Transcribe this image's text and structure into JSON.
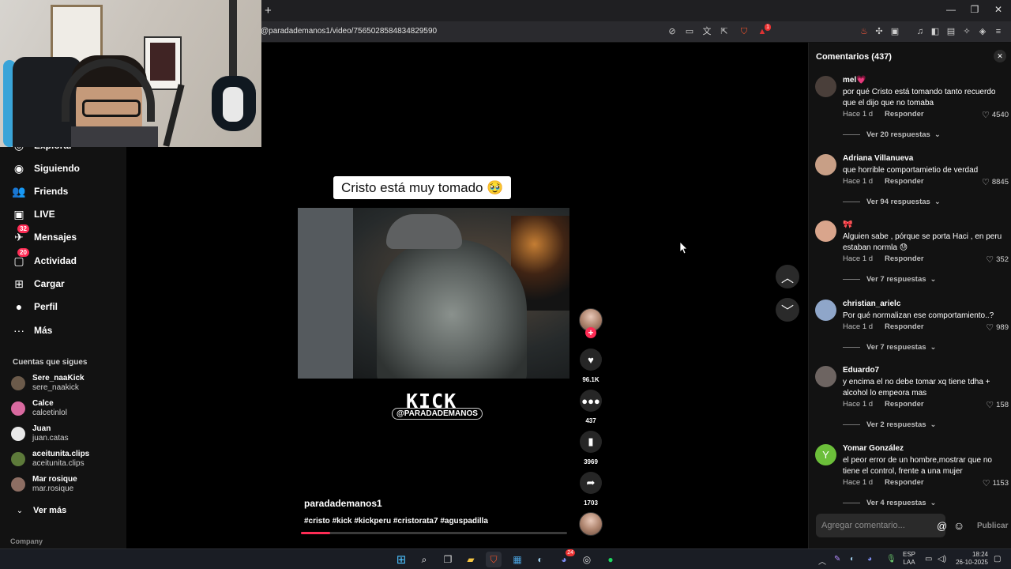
{
  "browser": {
    "new_tab": "+",
    "url": "@paradademanos1/video/7565028584834829590",
    "window_controls": [
      "—",
      "❐",
      "✕"
    ],
    "brave_badge": "1"
  },
  "nav": {
    "items": [
      {
        "label": "Explorar",
        "icon": "compass-icon",
        "glyph": "◎"
      },
      {
        "label": "Siguiendo",
        "icon": "following-icon",
        "glyph": "◉"
      },
      {
        "label": "Friends",
        "icon": "friends-icon",
        "glyph": "👥"
      },
      {
        "label": "LIVE",
        "icon": "live-icon",
        "glyph": "▣"
      },
      {
        "label": "Mensajes",
        "icon": "messages-icon",
        "glyph": "✈",
        "badge": "32"
      },
      {
        "label": "Actividad",
        "icon": "activity-icon",
        "glyph": "▢",
        "badge": "20"
      },
      {
        "label": "Cargar",
        "icon": "upload-icon",
        "glyph": "⊞"
      },
      {
        "label": "Perfil",
        "icon": "profile-icon",
        "glyph": "●"
      },
      {
        "label": "Más",
        "icon": "more-icon",
        "glyph": "···"
      }
    ],
    "following_header": "Cuentas que sigues",
    "accounts": [
      {
        "name": "Sere_naaKick",
        "handle": "sere_naakick",
        "color": "#6b5a4a"
      },
      {
        "name": "Calce",
        "handle": "calcetinlol",
        "color": "#d96aa0"
      },
      {
        "name": "Juan",
        "handle": "juan.catas",
        "color": "#e8e8e8"
      },
      {
        "name": "aceitunita.clips",
        "handle": "aceitunita.clips",
        "color": "#5d7a3a"
      },
      {
        "name": "Mar rosique",
        "handle": "mar.rosique",
        "color": "#8d6e63"
      }
    ],
    "see_more": "Ver más",
    "company": "Company"
  },
  "video": {
    "caption": "Cristo está muy tomado 🥹",
    "kick_logo": "KICK",
    "kick_handle": "@PARADADEMANOS",
    "username": "paradademanos1",
    "hashtags": "#cristo #kick #kickperu #cristorata7 #aguspadilla",
    "progress": 0.11,
    "accent": "#fe2c55"
  },
  "actions": {
    "follow": "+",
    "likes": "96.1K",
    "comments": "437",
    "saves": "3969",
    "shares": "1703"
  },
  "comments_panel": {
    "title": "Comentarios (437)",
    "close": "✕",
    "items": [
      {
        "user": "mel💗",
        "text": "por qué Cristo está tomando tanto recuerdo que el dijo que no tomaba",
        "time": "Hace 1 d",
        "reply": "Responder",
        "likes": "4540",
        "replies": "Ver 20 respuestas",
        "avatar_color": "#4a3f3a",
        "avatar_letter": ""
      },
      {
        "user": "Adriana Villanueva",
        "text": "que horrible comportamietio de verdad",
        "time": "Hace 1 d",
        "reply": "Responder",
        "likes": "8845",
        "replies": "Ver 94 respuestas",
        "avatar_color": "#c89f86",
        "avatar_letter": ""
      },
      {
        "user": "🎀",
        "text": "Alguien sabe , pórque se porta Haci , en peru estaban normla 😓",
        "time": "Hace 1 d",
        "reply": "Responder",
        "likes": "352",
        "replies": "Ver 7 respuestas",
        "avatar_color": "#d9a58c",
        "avatar_letter": ""
      },
      {
        "user": "christian_arielc",
        "text": "Por qué normalizan ese comportamiento..?",
        "time": "Hace 1 d",
        "reply": "Responder",
        "likes": "989",
        "replies": "Ver 7 respuestas",
        "avatar_color": "#8fa6c9",
        "avatar_letter": ""
      },
      {
        "user": "Eduardo7",
        "text": "y encima el no debe tomar xq tiene tdha + alcohol lo empeora mas",
        "time": "Hace 1 d",
        "reply": "Responder",
        "likes": "158",
        "replies": "Ver 2 respuestas",
        "avatar_color": "#6d6461",
        "avatar_letter": ""
      },
      {
        "user": "Yomar González",
        "text": "el peor error de un hombre,mostrar que no tiene el control, frente a una mujer",
        "time": "Hace 1 d",
        "reply": "Responder",
        "likes": "1153",
        "replies": "Ver 4 respuestas",
        "avatar_color": "#6cbf3a",
        "avatar_letter": "Y"
      }
    ],
    "input_placeholder": "Agregar comentario...",
    "mention": "@",
    "emoji": "☺",
    "publish": "Publicar"
  },
  "taskbar": {
    "lang_top": "ESP",
    "lang_bottom": "LAA",
    "time": "18:24",
    "date": "26-10-2025",
    "discord_badge": "24"
  }
}
